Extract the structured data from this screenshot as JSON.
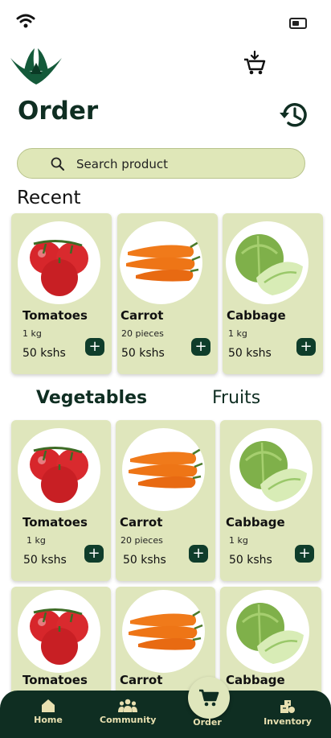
{
  "status": {
    "wifi_icon": "wifi-icon",
    "battery_icon": "battery-icon"
  },
  "header": {
    "title": "Order",
    "cart_icon": "cart-download-icon",
    "history_icon": "history-icon"
  },
  "search": {
    "placeholder": "Search product"
  },
  "recent": {
    "heading": "Recent",
    "items": [
      {
        "name": "Tomatoes",
        "qty": "1 kg",
        "price": "50 kshs"
      },
      {
        "name": "Carrot",
        "qty": "20 pieces",
        "price": "50 kshs"
      },
      {
        "name": "Cabbage",
        "qty": "1 kg",
        "price": "50 kshs"
      }
    ]
  },
  "tabs": {
    "vegetables": "Vegetables",
    "fruits": "Fruits"
  },
  "grid": {
    "row1": [
      {
        "name": "Tomatoes",
        "qty": "1 kg",
        "price": "50 kshs"
      },
      {
        "name": "Carrot",
        "qty": "20 pieces",
        "price": "50 kshs"
      },
      {
        "name": "Cabbage",
        "qty": "1 kg",
        "price": "50 kshs"
      }
    ],
    "row2": [
      {
        "name": "Tomatoes"
      },
      {
        "name": "Carrot"
      },
      {
        "name": "Cabbage"
      }
    ]
  },
  "nav": {
    "home": "Home",
    "community": "Community",
    "order": "Order",
    "inventory": "Inventory"
  },
  "colors": {
    "accent": "#0f2e22",
    "card": "#dfe6bc",
    "nav_text": "#e8e0b0"
  }
}
